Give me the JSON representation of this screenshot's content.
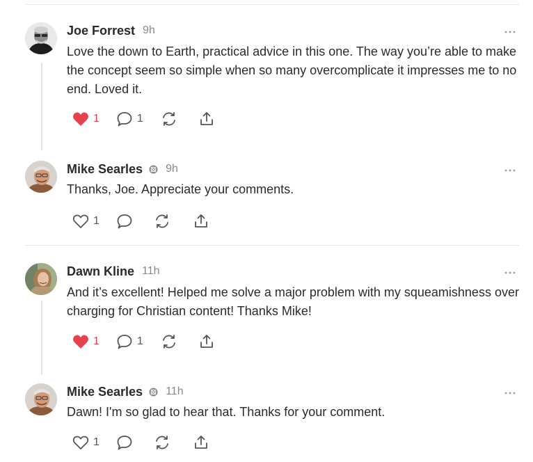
{
  "comments": [
    {
      "author": "Joe Forrest",
      "time": "9h",
      "text": "Love the down to Earth, practical advice in this one. The way you’re able to make the concept seem so simple when so many overcomplicate it impresses me to no end. Loved it.",
      "likes": "1",
      "liked": true,
      "replies": "1"
    },
    {
      "author": "Mike Searles",
      "time": "9h",
      "text": "Thanks, Joe. Appreciate your comments.",
      "likes": "1",
      "liked": false,
      "replies": ""
    },
    {
      "author": "Dawn Kline",
      "time": "11h",
      "text": "And it’s excellent! Helped me solve a major problem with my squeamishness over charging for Christian content! Thanks Mike!",
      "likes": "1",
      "liked": true,
      "replies": "1"
    },
    {
      "author": "Mike Searles",
      "time": "11h",
      "text": "Dawn! I'm so glad to hear that. Thanks for your comment.",
      "likes": "1",
      "liked": false,
      "replies": ""
    }
  ],
  "colors": {
    "like_red": "#e4434f",
    "icon_gray": "#555555",
    "divider": "#e6e6e6"
  },
  "icons": [
    "heart-icon",
    "comment-bubble-icon",
    "restack-icon",
    "share-icon",
    "more-icon",
    "author-badge-icon"
  ]
}
